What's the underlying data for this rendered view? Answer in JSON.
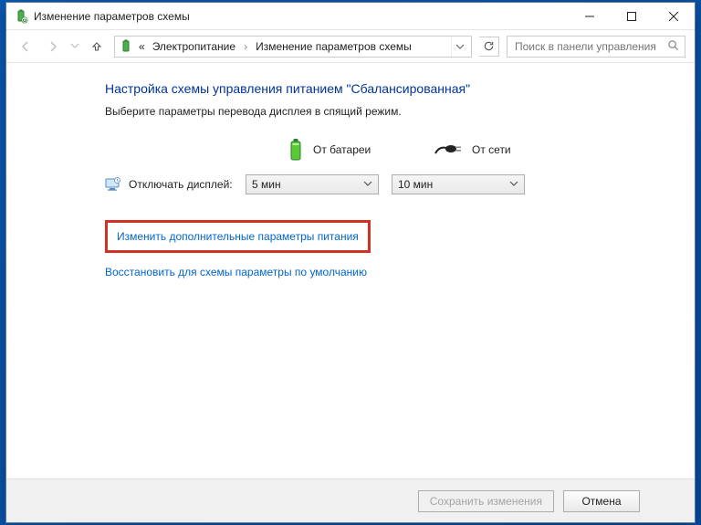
{
  "window": {
    "title": "Изменение параметров схемы"
  },
  "breadcrumb": {
    "prefix": "«",
    "item1": "Электропитание",
    "item2": "Изменение параметров схемы"
  },
  "search": {
    "placeholder": "Поиск в панели управления"
  },
  "page": {
    "heading": "Настройка схемы управления питанием \"Сбалансированная\"",
    "subtext": "Выберите параметры перевода дисплея в спящий режим."
  },
  "columns": {
    "battery": "От батареи",
    "plugged": "От сети"
  },
  "setting": {
    "turn_off_display": "Отключать дисплей:",
    "battery_value": "5 мин",
    "plugged_value": "10 мин"
  },
  "links": {
    "advanced": "Изменить дополнительные параметры питания",
    "restore": "Восстановить для схемы параметры по умолчанию"
  },
  "buttons": {
    "save": "Сохранить изменения",
    "cancel": "Отмена"
  }
}
